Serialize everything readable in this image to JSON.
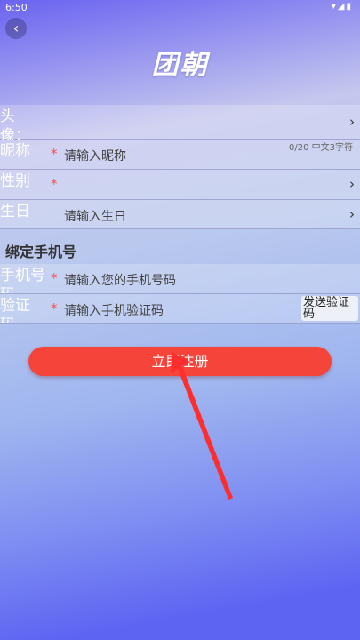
{
  "status": {
    "time": "6:50",
    "icons": "▾◢▮"
  },
  "header": {
    "back_icon": "‹",
    "logo": "团朝"
  },
  "form": {
    "avatar_label": "头像：",
    "nickname": {
      "label": "昵称",
      "required": "*",
      "placeholder": "请输入昵称",
      "counter": "0/20  中文3字符"
    },
    "gender": {
      "label": "性别",
      "required": "*"
    },
    "birthday": {
      "label": "生日",
      "placeholder": "请输入生日"
    },
    "arrow": "›"
  },
  "phone_section": {
    "title": "绑定手机号",
    "phone": {
      "label": "手机号码",
      "required": "*",
      "placeholder": "请输入您的手机号码"
    },
    "code": {
      "label": "验证码",
      "required": "*",
      "placeholder": "请输入手机验证码",
      "send_button": "发送验证码"
    }
  },
  "register_button": "立即注册",
  "colors": {
    "accent": "#f5453a",
    "required": "#ff4c4c"
  }
}
